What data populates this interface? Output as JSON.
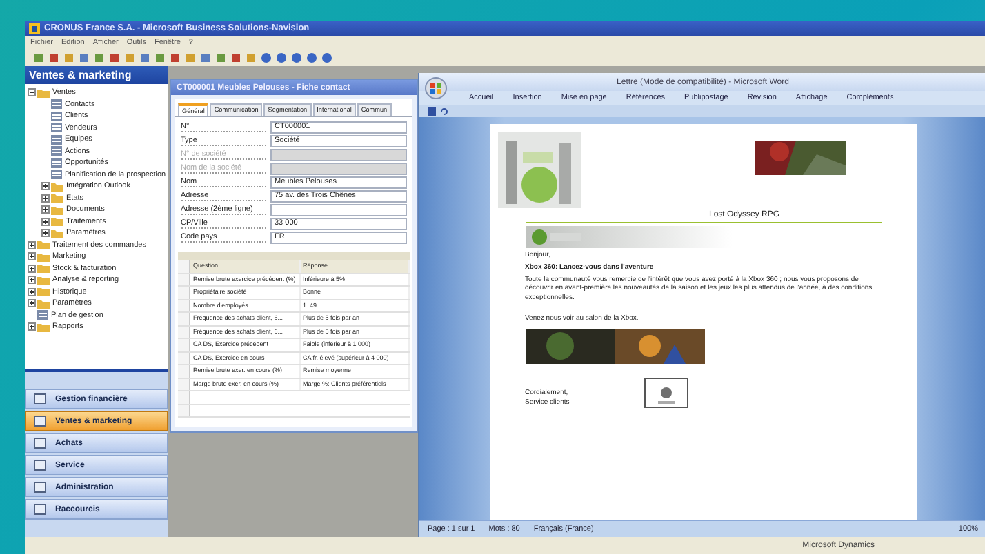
{
  "app": {
    "title": "CRONUS France S.A. - Microsoft Business Solutions-Navision",
    "menu": [
      "Fichier",
      "Edition",
      "Afficher",
      "Outils",
      "Fenêtre",
      "?"
    ]
  },
  "sidebar": {
    "title": "Ventes & marketing",
    "tree": [
      {
        "label": "Ventes",
        "kind": "folder",
        "expanded": true,
        "children": [
          {
            "label": "Contacts",
            "kind": "item"
          },
          {
            "label": "Clients",
            "kind": "item"
          },
          {
            "label": "Vendeurs",
            "kind": "item"
          },
          {
            "label": "Equipes",
            "kind": "item"
          },
          {
            "label": "Actions",
            "kind": "item"
          },
          {
            "label": "Opportunités",
            "kind": "item"
          },
          {
            "label": "Planification de la prospection",
            "kind": "item"
          },
          {
            "label": "Intégration Outlook",
            "kind": "folder",
            "expanded": false
          },
          {
            "label": "Etats",
            "kind": "folder",
            "expanded": false
          },
          {
            "label": "Documents",
            "kind": "folder",
            "expanded": false
          },
          {
            "label": "Traitements",
            "kind": "folder",
            "expanded": false
          },
          {
            "label": "Paramètres",
            "kind": "folder",
            "expanded": false
          }
        ]
      },
      {
        "label": "Traitement des commandes",
        "kind": "folder",
        "expanded": false
      },
      {
        "label": "Marketing",
        "kind": "folder",
        "expanded": false
      },
      {
        "label": "Stock & facturation",
        "kind": "folder",
        "expanded": false
      },
      {
        "label": "Analyse & reporting",
        "kind": "folder",
        "expanded": false
      },
      {
        "label": "Historique",
        "kind": "folder",
        "expanded": false
      },
      {
        "label": "Paramètres",
        "kind": "folder",
        "expanded": false
      },
      {
        "label": "Plan de gestion",
        "kind": "item"
      },
      {
        "label": "Rapports",
        "kind": "folder",
        "expanded": false
      }
    ],
    "nav_buttons": [
      {
        "label": "Gestion financière",
        "selected": false
      },
      {
        "label": "Ventes & marketing",
        "selected": true
      },
      {
        "label": "Achats",
        "selected": false
      },
      {
        "label": "Service",
        "selected": false
      },
      {
        "label": "Administration",
        "selected": false
      },
      {
        "label": "Raccourcis",
        "selected": false
      }
    ]
  },
  "contact_card": {
    "title": "CT000001 Meubles Pelouses - Fiche contact",
    "tabs": [
      {
        "label": "Général",
        "selected": true
      },
      {
        "label": "Communication",
        "selected": false
      },
      {
        "label": "Segmentation",
        "selected": false
      },
      {
        "label": "International",
        "selected": false
      },
      {
        "label": "Commun",
        "selected": false
      }
    ],
    "fields": [
      {
        "label": "N°",
        "value": "CT000001",
        "disabled": false
      },
      {
        "label": "Type",
        "value": "Société",
        "disabled": false
      },
      {
        "label": "N° de société",
        "disabled": true
      },
      {
        "label": "Nom de la société",
        "disabled": true
      },
      {
        "label": "Nom",
        "value": "Meubles Pelouses",
        "disabled": false
      },
      {
        "label": "Adresse",
        "value": "75 av. des Trois Chênes",
        "disabled": false
      },
      {
        "label": "Adresse (2ème ligne)",
        "disabled": false
      },
      {
        "label": "CP/Ville",
        "value": "33 000",
        "disabled": false
      },
      {
        "label": "Code pays",
        "value": "FR",
        "disabled": false
      }
    ],
    "profile_table": {
      "columns": [
        "Question",
        "Réponse"
      ],
      "rows": [
        [
          "Remise brute exercice précédent (%)",
          "Inférieure à 5%"
        ],
        [
          "Propriétaire société",
          "Bonne"
        ],
        [
          "Nombre d'employés",
          "1..49"
        ],
        [
          "Fréquence des achats client, 6...",
          "Plus de 5 fois par an"
        ],
        [
          "Fréquence des achats client, 6...",
          "Plus de 5 fois par an"
        ],
        [
          "CA DS, Exercice précédent",
          "Faible (inférieur à 1 000)"
        ],
        [
          "CA DS, Exercice en cours",
          "CA fr. élevé (supérieur à 4 000)"
        ],
        [
          "Remise brute exer. en cours (%)",
          "Remise moyenne"
        ],
        [
          "Marge brute exer. en cours (%)",
          "Marge %: Clients préférentiels"
        ]
      ]
    }
  },
  "word": {
    "title": "Lettre (Mode de compatibilité) - Microsoft Word",
    "ribbon_tabs": [
      "Accueil",
      "Insertion",
      "Mise en page",
      "Références",
      "Publipostage",
      "Révision",
      "Affichage",
      "Compléments"
    ],
    "document": {
      "heading": "Lost Odyssey RPG",
      "greeting": "Bonjour,",
      "subject": "Xbox 360: Lancez-vous dans l'aventure",
      "body": "Toute la communauté vous remercie de l'intérêt que vous avez porté à la Xbox 360 ; nous vous proposons de découvrir en avant-première les nouveautés de la saison et les jeux les plus attendus de l'année, à des conditions exceptionnelles.",
      "invite": "Venez nous voir au salon de la Xbox.",
      "closing": "Cordialement,",
      "signature": "Service clients"
    },
    "status_bar": {
      "page": "Page : 1 sur 1",
      "words": "Mots : 80",
      "language": "Français (France)",
      "zoom": "100%"
    }
  },
  "taskbar": {
    "label": "Microsoft Dynamics"
  }
}
